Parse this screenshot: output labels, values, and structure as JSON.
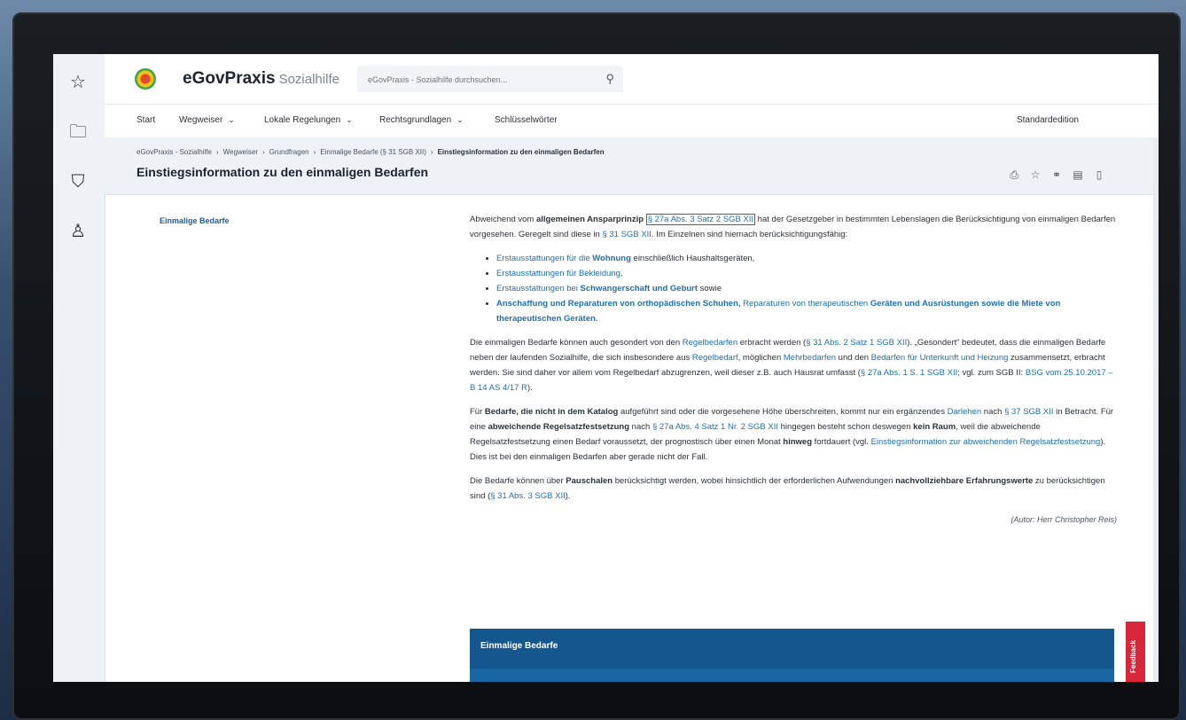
{
  "rail": {
    "icons": [
      "star-icon",
      "folder-icon",
      "basket-icon",
      "user-icon"
    ]
  },
  "header": {
    "brand_name": "eGovPraxis",
    "brand_sub": "Sozialhilfe",
    "search_placeholder": "eGovPraxis - Sozialhilfe durchsuchen..."
  },
  "nav": {
    "items": [
      {
        "label": "Start"
      },
      {
        "label": "Wegweiser",
        "dropdown": true
      },
      {
        "label": "Lokale Regelungen",
        "dropdown": true
      },
      {
        "label": "Rechtsgrundlagen",
        "dropdown": true
      },
      {
        "label": "Schlüsselwörter"
      }
    ],
    "edition": "Standardedition"
  },
  "breadcrumb": [
    "eGovPraxis - Sozialhilfe",
    "Wegweiser",
    "Grundfragen",
    "Einmalige Bedarfe (§ 31 SGB XII)",
    "Einstiegsinformation zu den einmaligen Bedarfen"
  ],
  "page_title": "Einstiegsinformation zu den einmaligen Bedarfen",
  "toc": {
    "item": "Einmalige Bedarfe"
  },
  "article": {
    "p1": {
      "t1": "Abweichend vom ",
      "b1": "allgemeinen Ansparprinzip",
      "l1": "§ 27a Abs. 3 Satz 2 SGB XII",
      "t2": " hat der Gesetzgeber in bestimmten Lebenslagen die Berücksichtigung von einmaligen Bedarfen vorgesehen. Geregelt sind diese in ",
      "l2": "§ 31 SGB XII",
      "t3": ". Im Einzelnen sind hiernach berücksichtigungsfähig:"
    },
    "list": {
      "i1a": "Erstausstattungen für die ",
      "i1b": "Wohnung",
      "i1c": " einschließlich Haushaltsgeräten,",
      "i2": "Erstausstattungen für Bekleidung,",
      "i3a": "Erstausstattungen bei ",
      "i3b": "Schwangerschaft und Geburt",
      "i3c": " sowie",
      "i4a": "Anschaffung und Reparaturen von orthopädischen Schuhen,",
      "i4b": " Reparaturen von therapeutischen ",
      "i4c": "Geräten und Ausrüstungen sowie die Miete von therapeutischen Geräten."
    },
    "p2": {
      "t1": "Die einmaligen Bedarfe können auch gesondert von den ",
      "l1": "Regelbedarfen",
      "t2": " erbracht werden (",
      "l2": "§ 31 Abs. 2 Satz 1 SGB XII",
      "t3": "). „Gesondert“ bedeutet, dass die einmaligen Bedarfe neben der laufenden Sozialhilfe, die sich insbesondere aus ",
      "l3": "Regelbedarf",
      "t4": ", möglichen ",
      "l4": "Mehrbedarfen",
      "t5": " und den ",
      "l5": "Bedarfen für Unterkunft und Heizung",
      "t6": " zusammensetzt, erbracht werden. Sie sind daher vor allem vom Regelbedarf abzugrenzen, weil dieser z.B. auch Hausrat umfasst (",
      "l6": "§ 27a Abs. 1 S. 1 SGB XII",
      "t7": "; vgl. zum SGB II: ",
      "l7": "BSG vom 25.10.2017 – B 14 AS 4/17 R",
      "t8": ")."
    },
    "p3": {
      "t1": "Für ",
      "b1": "Bedarfe, die nicht in dem Katalog",
      "t2": " aufgeführt sind oder die vorgesehene Höhe überschreiten, kommt nur ein ergänzendes ",
      "l1": "Darlehen",
      "t3": " nach ",
      "l2": "§ 37 SGB XII",
      "t4": " in Betracht. Für eine ",
      "b2": "abweichende Regelsatzfestsetzung",
      "t5": " nach ",
      "l3": "§ 27a Abs. 4 Satz 1 Nr. 2 SGB XII",
      "t6": " hingegen besteht schon deswegen ",
      "b3": "kein Raum",
      "t7": ", weil die abweichende Regelsatzfestsetzung einen Bedarf voraussetzt, der prognostisch über einen Monat ",
      "b4": "hinweg",
      "t8": " fortdauert (vgl. ",
      "l4": "Einstiegsinformation zur abweichenden Regelsatzfestsetzung",
      "t9": "). Dies ist bei den einmaligen Bedarfen aber gerade nicht der Fall."
    },
    "p4": {
      "t1": "Die Bedarfe können über ",
      "b1": "Pauschalen",
      "t2": " berücksichtigt werden, wobei hinsichtlich der erforderlichen Aufwendungen ",
      "b2": "nachvollziehbare Erfahrungswerte",
      "t3": " zu berücksichtigen sind (",
      "l1": "§ 31 Abs. 3 SGB XII",
      "t4": ")."
    },
    "author": "(Autor: Herr Christopher Reis)"
  },
  "box": {
    "title": "Einmalige Bedarfe"
  },
  "feedback": "Feedback"
}
